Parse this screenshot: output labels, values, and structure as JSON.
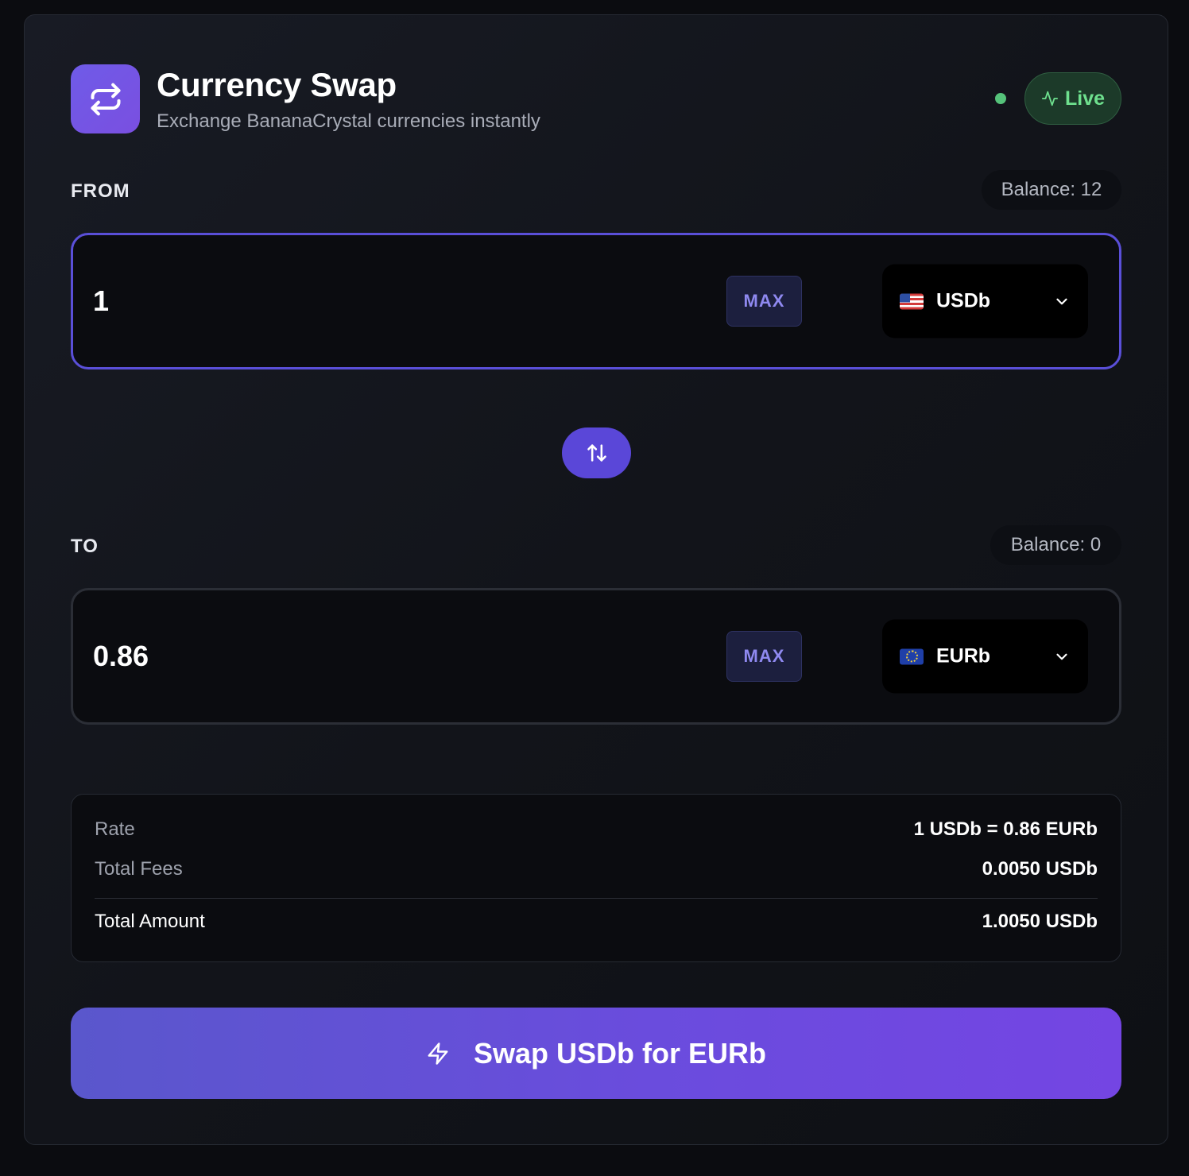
{
  "header": {
    "title": "Currency Swap",
    "subtitle": "Exchange BananaCrystal currencies instantly",
    "status_label": "Live",
    "logo_icon": "swap-arrows-icon",
    "status_icon": "activity-icon"
  },
  "from": {
    "label": "FROM",
    "balance": "Balance: 12",
    "amount": "1",
    "max_label": "MAX",
    "currency": "USDb",
    "flag": "us-flag-icon"
  },
  "to": {
    "label": "TO",
    "balance": "Balance: 0",
    "amount": "0.86",
    "max_label": "MAX",
    "currency": "EURb",
    "flag": "eu-flag-icon"
  },
  "summary": {
    "rate_label": "Rate",
    "rate_value": "1 USDb = 0.86 EURb",
    "fees_label": "Total Fees",
    "fees_value": "0.0050 USDb",
    "total_label": "Total Amount",
    "total_value": "1.0050 USDb"
  },
  "action": {
    "label": "Swap USDb for EURb",
    "icon": "lightning-icon"
  },
  "colors": {
    "accent": "#5a47d8",
    "live_green": "#6ee08e",
    "max_text": "#8f89f0",
    "background": "#0b0c10"
  }
}
